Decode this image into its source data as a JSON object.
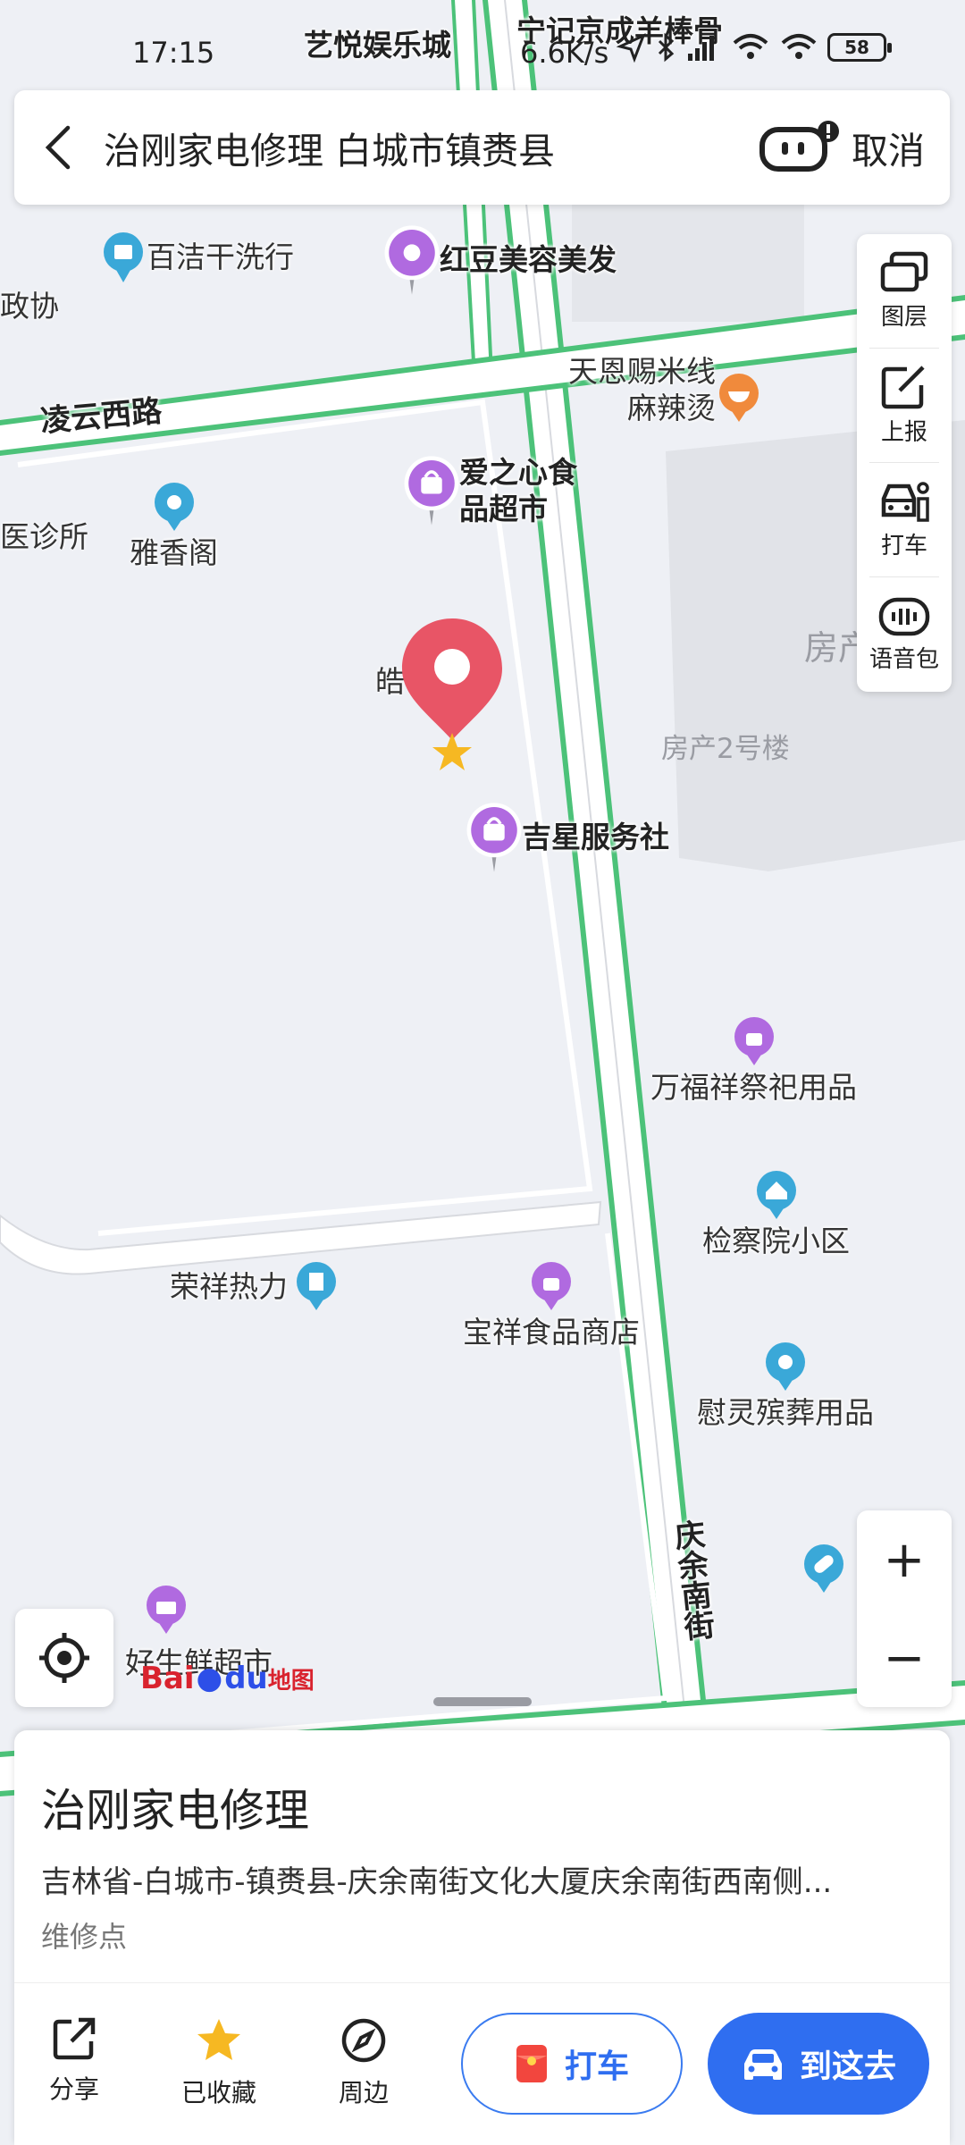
{
  "status_bar": {
    "time": "17:15",
    "network_speed": "6.6K/s",
    "battery": "58"
  },
  "search": {
    "query": "治刚家电修理 白城市镇赉县",
    "cancel_label": "取消"
  },
  "tools": [
    {
      "label": "图层"
    },
    {
      "label": "上报"
    },
    {
      "label": "打车"
    },
    {
      "label": "语音包"
    }
  ],
  "map": {
    "roads": {
      "lingyun": "凌云西路",
      "qingyu": "庆余南街"
    },
    "buildings": {
      "fangchan2": "房产2号楼",
      "fangchan_partial": "房产"
    },
    "pois": {
      "yiyue": "艺悦娱乐城",
      "ningji": "宁记京成羊棒骨",
      "zhengxie": "政协",
      "baijie": "百洁干洗行",
      "hongdou": "红豆美容美发",
      "tianen_1": "天恩赐米线",
      "tianen_2": "麻辣烫",
      "aizhixin_1": "爱之心食",
      "aizhixin_2": "品超市",
      "yizhensuo": "医诊所",
      "yaxiang": "雅香阁",
      "hao": "皓",
      "jixing": "吉星服务社",
      "wanfuxiang": "万福祥祭祀用品",
      "jianchayuan": "检察院小区",
      "rongxiang": "荣祥热力",
      "baoxiang": "宝祥食品商店",
      "weiling": "慰灵殡葬用品",
      "haosheng": "好生鲜超市"
    },
    "colors": {
      "road_green": "#4cc279",
      "marker_red": "#e85566",
      "poi_purple": "#b06ae0",
      "poi_blue": "#3aa8d8"
    }
  },
  "zoom": {
    "plus": "+",
    "minus": "−"
  },
  "logo": {
    "bai": "Bai",
    "du": "du",
    "map": "地图"
  },
  "card": {
    "name": "治刚家电修理",
    "address": "吉林省-白城市-镇赉县-庆余南街文化大厦庆余南街西南侧...",
    "category": "维修点",
    "actions": {
      "share": "分享",
      "collected": "已收藏",
      "nearby": "周边"
    },
    "taxi_label": "打车",
    "go_label": "到这去",
    "primary_color": "#2f6ef0"
  }
}
